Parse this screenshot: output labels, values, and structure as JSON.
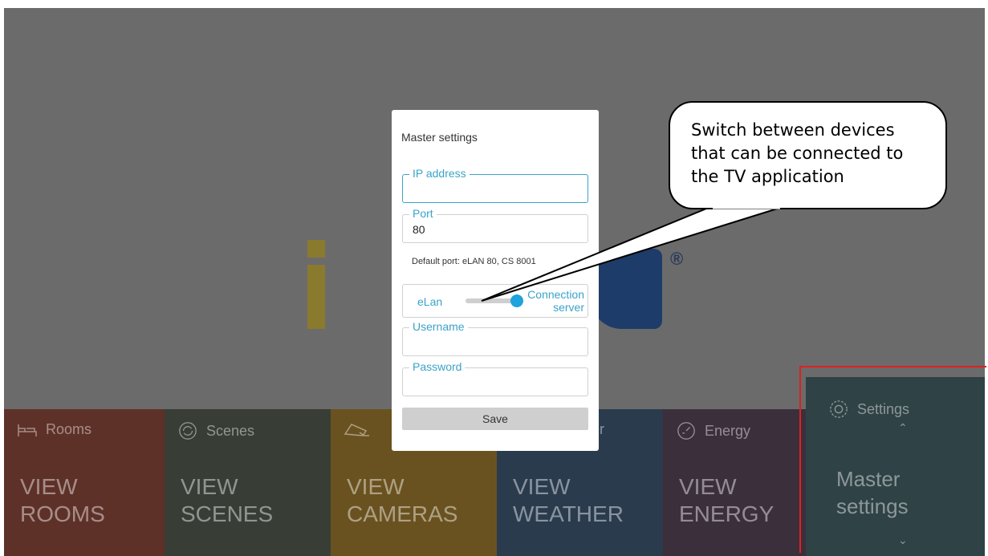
{
  "dialog": {
    "title": "Master settings",
    "ip_label": "IP address",
    "ip_value": "",
    "port_label": "Port",
    "port_value": "80",
    "hint": "Default port: eLAN 80, CS 8001",
    "switch_left": "eLan",
    "switch_right": "Connection server",
    "switch_state": "Connection server",
    "username_label": "Username",
    "username_value": "",
    "password_label": "Password",
    "password_value": "",
    "save_label": "Save"
  },
  "tiles": {
    "rooms": {
      "label": "Rooms",
      "big": "VIEW\nROOMS",
      "icon": "bed-icon"
    },
    "scenes": {
      "label": "Scenes",
      "big": "VIEW\nSCENES",
      "icon": "refresh-icon"
    },
    "cameras": {
      "label": "",
      "big": "VIEW\nCAMERAS",
      "icon": "camera-icon"
    },
    "weather": {
      "label": "er",
      "big": "VIEW\nWEATHER"
    },
    "energy": {
      "label": "Energy",
      "big": "VIEW\nENERGY",
      "icon": "gauge-icon"
    },
    "settings": {
      "label": "Settings",
      "big": "Master\nsettings",
      "icon": "gear-icon"
    }
  },
  "callout": {
    "text": "Switch between devices\nthat can be connected to\nthe TV application"
  },
  "colors": {
    "accent": "#3aa3c9",
    "knob": "#1ea3dc",
    "highlight": "#e02020"
  }
}
